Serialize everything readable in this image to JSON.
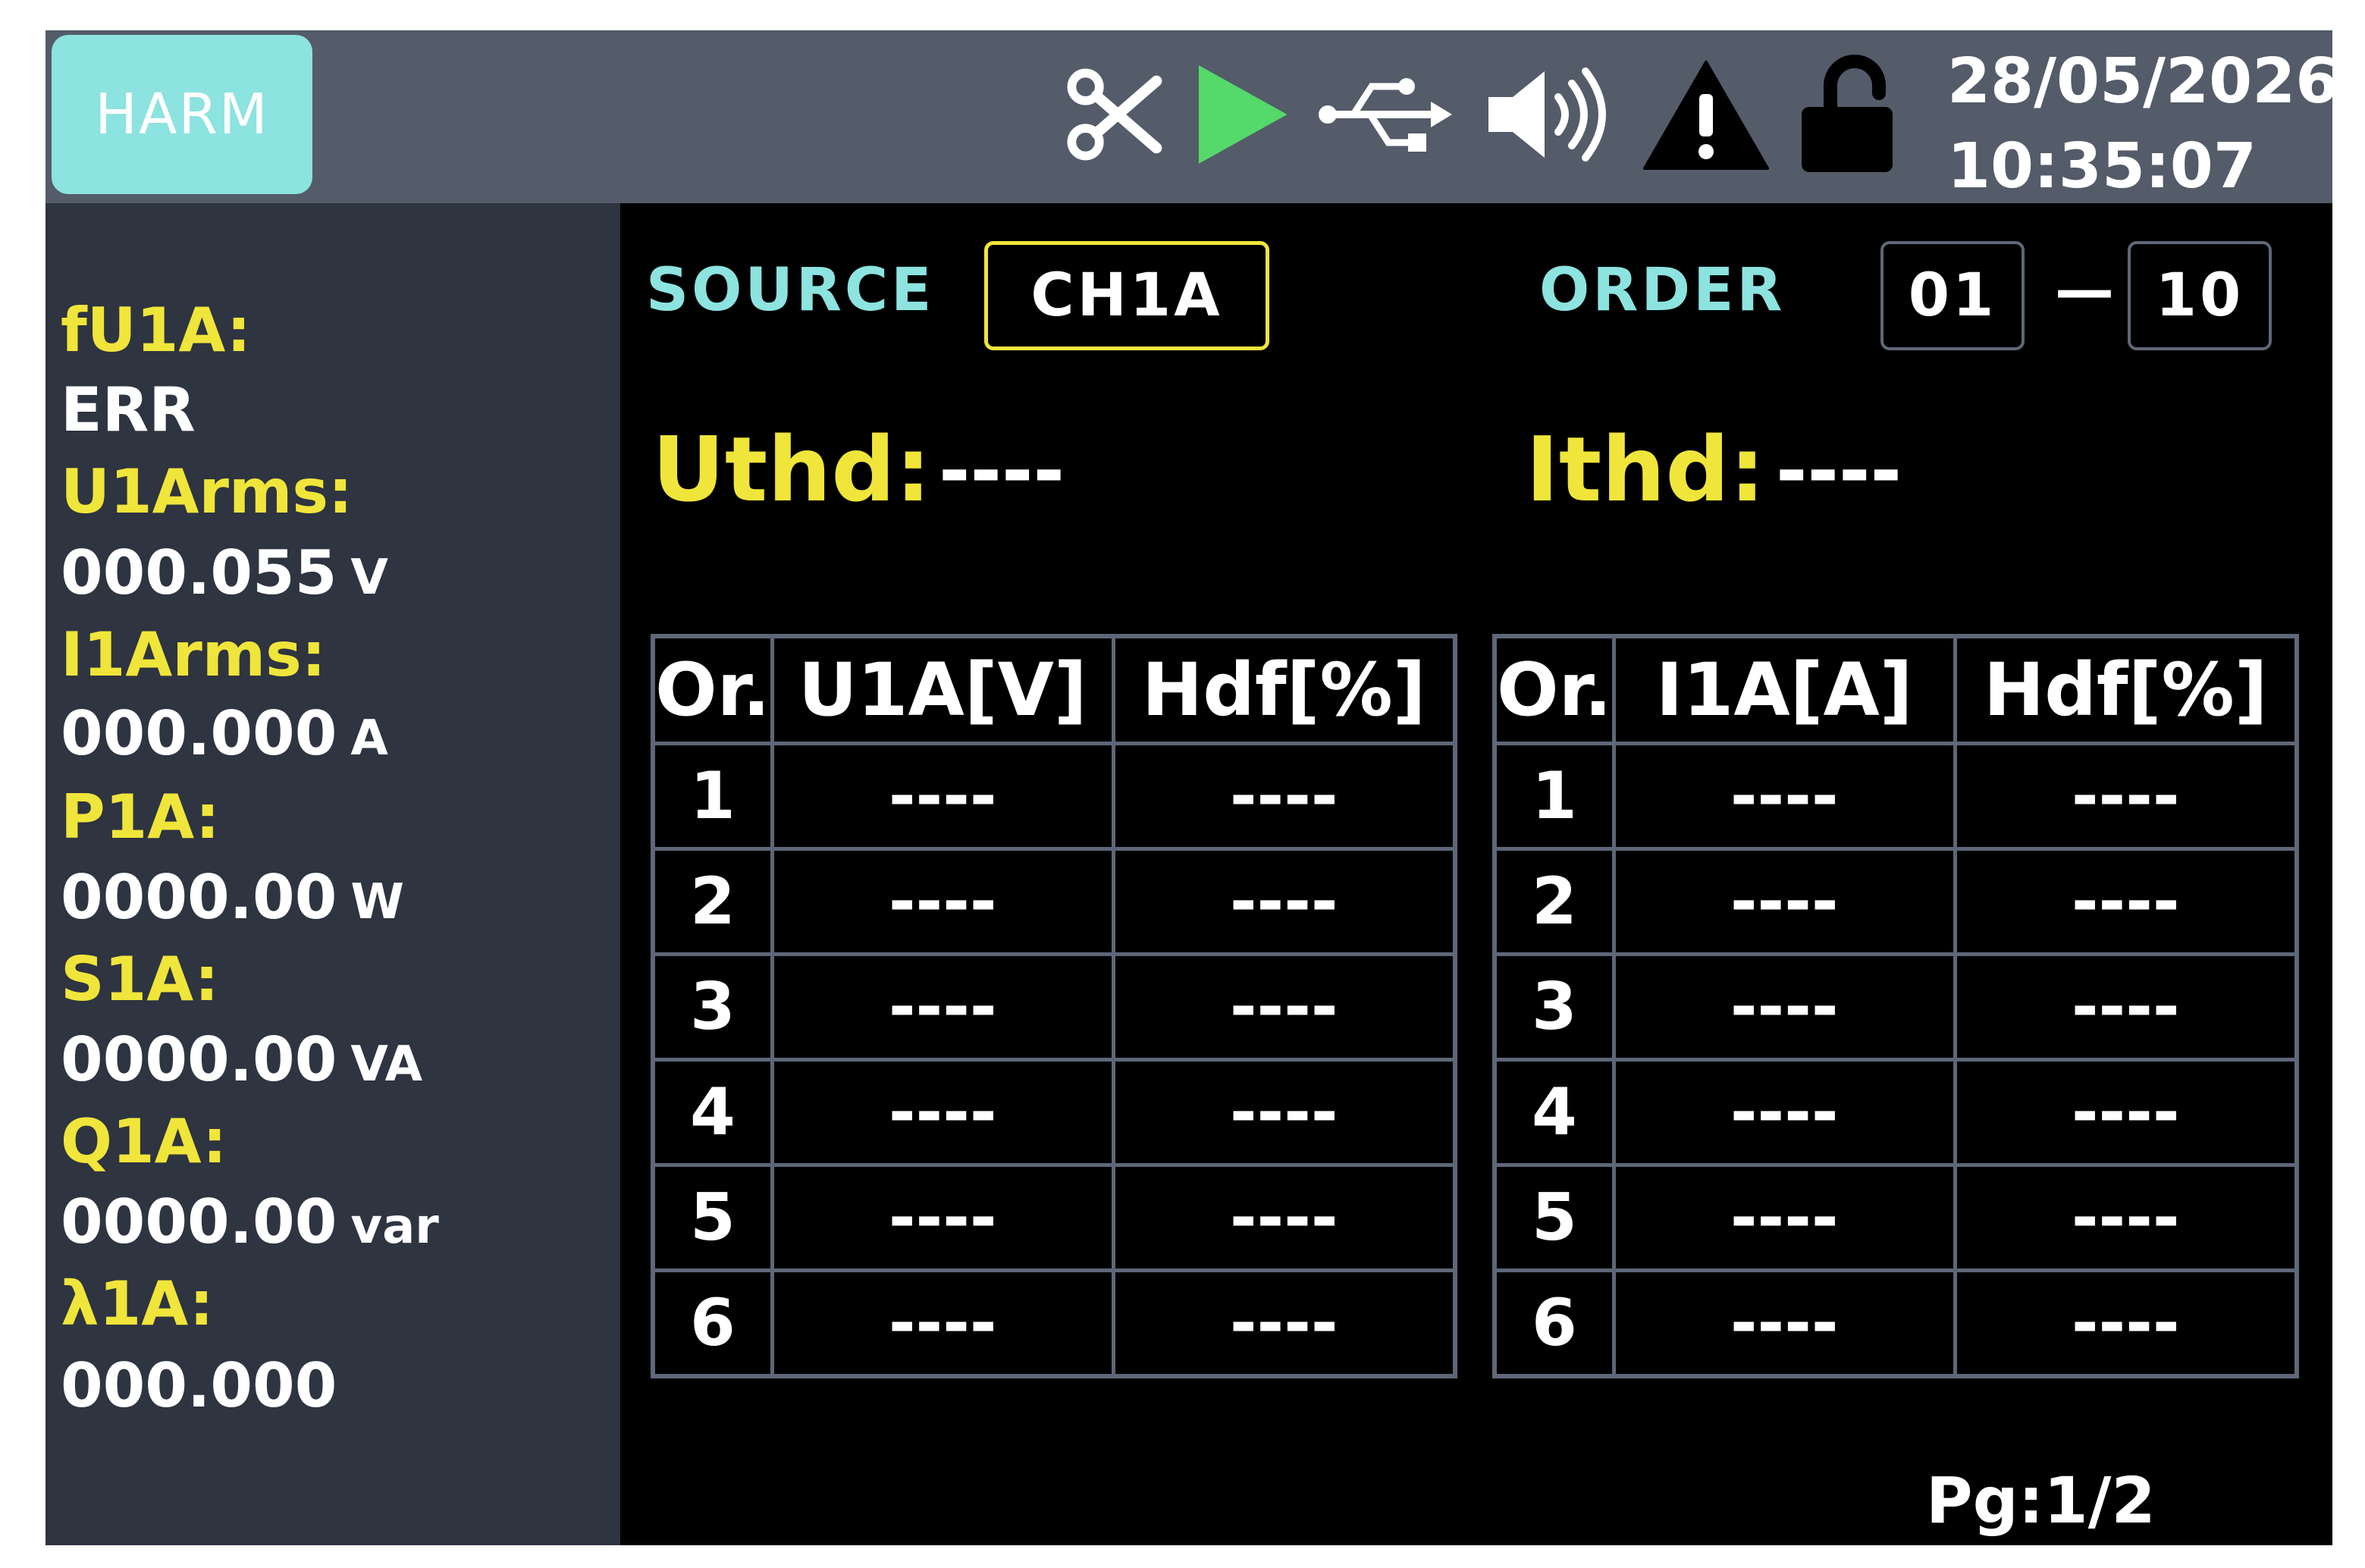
{
  "topbar": {
    "mode_label": "HARM",
    "icons": [
      "scissors-icon",
      "play-icon",
      "usb-icon",
      "speaker-icon",
      "warning-icon",
      "unlock-icon"
    ],
    "date": "28/05/2026",
    "time": "10:35:07"
  },
  "colors": {
    "mode_button_bg": "#8ce3df",
    "label_yellow": "#f0e53a",
    "label_cyan": "#8ce3df",
    "play_green": "#54d96a",
    "topbar_bg": "#545b69",
    "left_panel_bg": "#2e3440"
  },
  "measurements": [
    {
      "label": "fU1A:",
      "value": "ERR",
      "unit": ""
    },
    {
      "label": "U1Arms:",
      "value": "000.055",
      "unit": "V"
    },
    {
      "label": "I1Arms:",
      "value": "000.000",
      "unit": "A"
    },
    {
      "label": "P1A:",
      "value": "0000.00",
      "unit": "W"
    },
    {
      "label": "S1A:",
      "value": "0000.00",
      "unit": "VA"
    },
    {
      "label": "Q1A:",
      "value": "0000.00",
      "unit": "var"
    },
    {
      "label": "λ1A:",
      "value": "000.000",
      "unit": ""
    }
  ],
  "main": {
    "source_label": "SOURCE",
    "source_value": "CH1A",
    "order_label": "ORDER",
    "order_from": "01",
    "order_sep": "—",
    "order_to": "10",
    "uthd_label": "Uthd:",
    "uthd_value": "----",
    "ithd_label": "Ithd:",
    "ithd_value": "----",
    "voltage_table": {
      "headers": [
        "Or.",
        "U1A[V]",
        "Hdf[%]"
      ],
      "rows": [
        [
          "1",
          "----",
          "----"
        ],
        [
          "2",
          "----",
          "----"
        ],
        [
          "3",
          "----",
          "----"
        ],
        [
          "4",
          "----",
          "----"
        ],
        [
          "5",
          "----",
          "----"
        ],
        [
          "6",
          "----",
          "----"
        ]
      ]
    },
    "current_table": {
      "headers": [
        "Or.",
        "I1A[A]",
        "Hdf[%]"
      ],
      "rows": [
        [
          "1",
          "----",
          "----"
        ],
        [
          "2",
          "----",
          "----"
        ],
        [
          "3",
          "----",
          "----"
        ],
        [
          "4",
          "----",
          "----"
        ],
        [
          "5",
          "----",
          "----"
        ],
        [
          "6",
          "----",
          "----"
        ]
      ]
    },
    "page_indicator": "Pg:1/2"
  }
}
